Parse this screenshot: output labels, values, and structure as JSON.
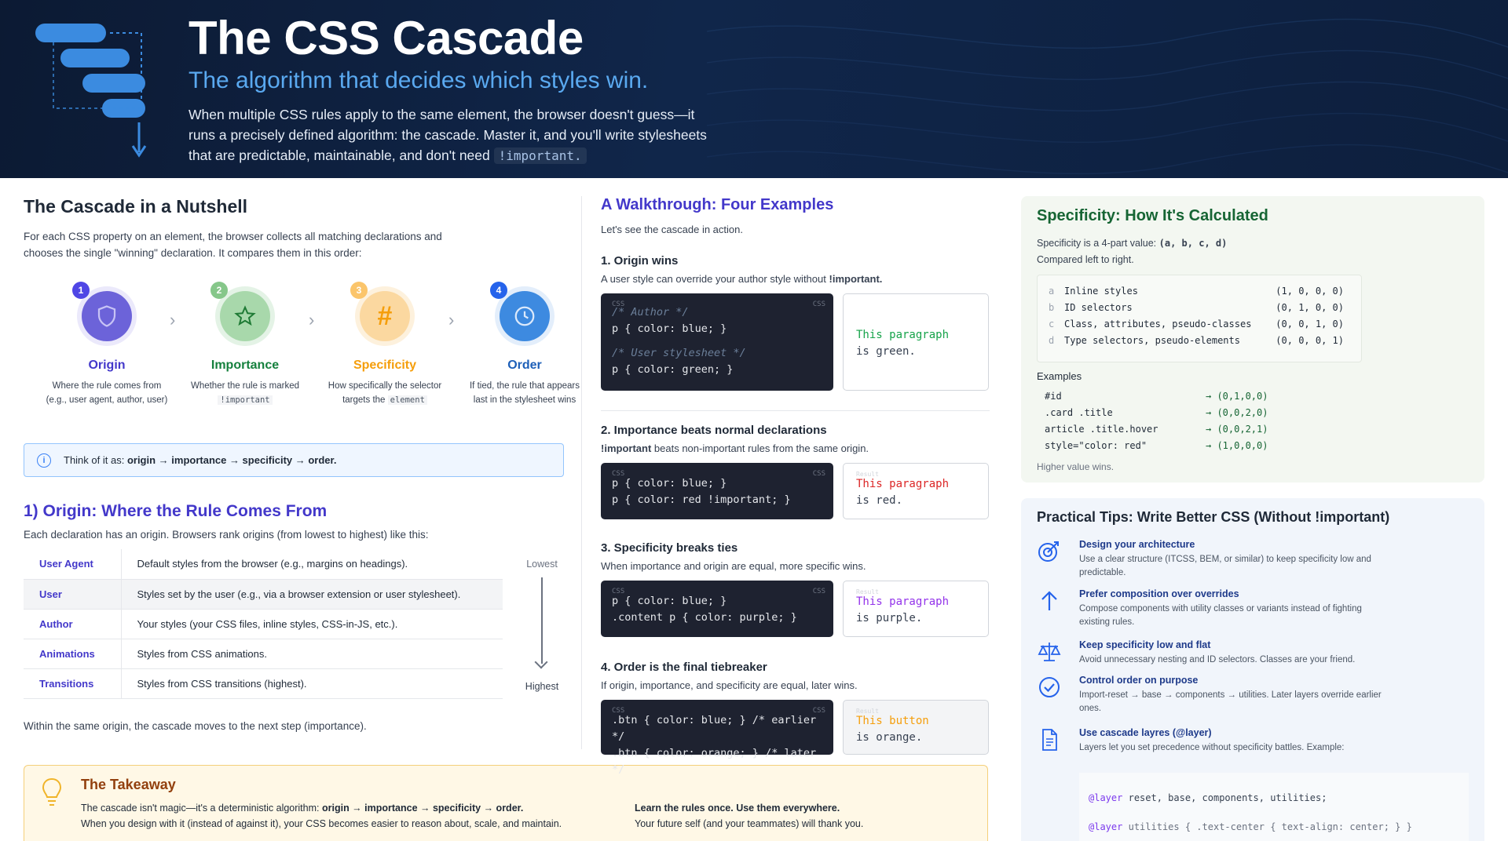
{
  "header": {
    "title": "The CSS Cascade",
    "subtitle": "The algorithm that decides which styles win.",
    "description": "When multiple CSS rules apply to the same element, the browser doesn't guess—it runs a precisely defined algorithm: the cascade. Master it, and you'll write stylesheets that are predictable, maintainable, and don't need",
    "description_code": "!important."
  },
  "nutshell": {
    "title": "The Cascade in a Nutshell",
    "intro": "For each CSS property on an element, the browser collects all matching declarations and chooses the single \"winning\" declaration. It compares them in this order:",
    "steps": [
      {
        "num": "1",
        "name": "Origin",
        "desc": "Where the rule comes from (e.g., user agent, author, user)",
        "icon": "shield-icon",
        "color": "#5b5bd6"
      },
      {
        "num": "2",
        "name": "Importance",
        "desc": "Whether the rule is marked",
        "code": "!important",
        "icon": "star-icon",
        "color": "#22a34a"
      },
      {
        "num": "3",
        "name": "Specificity",
        "desc": "How specifically the selector targets the",
        "code": "element",
        "icon": "hash-icon",
        "color": "#f59e0b"
      },
      {
        "num": "4",
        "name": "Order",
        "desc": "If tied, the rule that appears last in the stylesheet wins",
        "icon": "clock-icon",
        "color": "#2f7fd8"
      }
    ],
    "tip_prefix": "Think of it as:",
    "tip_bold": "origin → importance → specificity → order."
  },
  "origin": {
    "title": "1) Origin: Where the Rule Comes From",
    "intro": "Each declaration has an origin. Browsers rank origins (from lowest to highest) like this:",
    "rows": [
      {
        "name": "User Agent",
        "desc": "Default styles from the browser (e.g., margins on headings)."
      },
      {
        "name": "User",
        "desc": "Styles set by the user (e.g., via a browser extension or user stylesheet)."
      },
      {
        "name": "Author",
        "desc": "Your styles (your CSS files, inline styles, CSS-in-JS, etc.)."
      },
      {
        "name": "Animations",
        "desc": "Styles from CSS animations."
      },
      {
        "name": "Transitions",
        "desc": "Styles from CSS transitions (highest)."
      }
    ],
    "lowest": "Lowest",
    "highest": "Highest",
    "footer": "Within the same origin, the cascade moves to the next step (importance)."
  },
  "takeaway": {
    "title": "The Takeaway",
    "line1_prefix": "The cascade isn't magic—it's a deterministic algorithm:",
    "line1_bold": "origin → importance → specificity → order.",
    "line2": "When you design with it (instead of against it), your CSS becomes easier to reason about, scale, and maintain.",
    "right_bold": "Learn the rules once. Use them everywhere.",
    "right_line": "Your future self (and your teammates) will thank you."
  },
  "walkthrough": {
    "title": "A Walkthrough: Four Examples",
    "intro": "Let's see the cascade in action.",
    "examples": [
      {
        "heading": "1. Origin wins",
        "sub": "A user style can override your author style without",
        "sub_bold": "!important.",
        "code_label": "CSS",
        "code_label_right": "CSS",
        "lines": [
          "/* Author */",
          "p { color: blue; }",
          "/* User stylesheet */",
          "p { color: green; }"
        ],
        "out1": "This paragraph",
        "out2": "is green."
      },
      {
        "heading": "2. Importance beats normal declarations",
        "sub_bold": "!important",
        "sub": "beats non-important rules from the same origin.",
        "code_label": "CSS",
        "code_label_right": "CSS",
        "lines": [
          "p { color: blue; }",
          "p { color: red !important; }"
        ],
        "out_label": "Result",
        "out1": "This paragraph",
        "out2": "is red."
      },
      {
        "heading": "3. Specificity breaks ties",
        "sub": "When importance and origin are equal, more specific wins.",
        "code_label": "CSS",
        "code_label_right": "CSS",
        "lines": [
          "p { color: blue; }",
          ".content p { color: purple; }"
        ],
        "out_label": "Result",
        "out1": "This paragraph",
        "out2": "is purple."
      },
      {
        "heading": "4. Order is the final tiebreaker",
        "sub": "If origin, importance, and specificity are equal, later wins.",
        "code_label": "CSS",
        "code_label_right": "CSS",
        "lines": [
          ".btn { color: blue; }  /* earlier */",
          ".btn { color: orange; } /* later */"
        ],
        "out_label": "Result",
        "out1": "This button",
        "out2": "is orange."
      }
    ]
  },
  "specificity": {
    "title": "Specificity: How It's Calculated",
    "desc_prefix": "Specificity is a 4-part value:",
    "desc_bold": "(a, b, c, d)",
    "desc2": "Compared left to right.",
    "rows": [
      {
        "letter": "a",
        "label": "Inline styles",
        "value": "(1, 0, 0, 0)"
      },
      {
        "letter": "b",
        "label": "ID selectors",
        "value": "(0, 1, 0, 0)"
      },
      {
        "letter": "c",
        "label": "Class, attributes, pseudo-classes",
        "value": "(0, 0, 1, 0)"
      },
      {
        "letter": "d",
        "label": "Type selectors, pseudo-elements",
        "value": "(0, 0, 0, 1)"
      }
    ],
    "examples_title": "Examples",
    "examples": [
      {
        "sel": "#id",
        "value": "→ (0,1,0,0)"
      },
      {
        "sel": ".card .title",
        "value": "→ (0,0,2,0)"
      },
      {
        "sel": "article .title.hover",
        "value": "→ (0,0,2,1)"
      },
      {
        "sel": "style=\"color: red\"",
        "value": "→ (1,0,0,0)"
      }
    ],
    "footer": "Higher value wins."
  },
  "tips": {
    "title": "Practical Tips: Write Better CSS (Without !important)",
    "items": [
      {
        "icon": "target-icon",
        "title": "Design your architecture",
        "desc": "Use a clear structure (ITCSS, BEM, or similar) to keep specificity low and predictable."
      },
      {
        "icon": "arrow-up-icon",
        "title": "Prefer composition over overrides",
        "desc": "Compose components with utility classes or variants instead of fighting existing rules."
      },
      {
        "icon": "scale-icon",
        "title": "Keep specificity low and flat",
        "desc": "Avoid unnecessary nesting and ID selectors. Classes are your friend."
      },
      {
        "icon": "check-circle-icon",
        "title": "Control order on purpose",
        "desc": "Import-reset → base → components → utilities. Later layers override earlier ones."
      },
      {
        "icon": "document-icon",
        "title": "Use cascade layres (@layer)",
        "desc": "Layers let you set precedence without specificity battles. Example:"
      }
    ],
    "layer_line1_kw": "@layer",
    "layer_line1": "reset, base, components, utilities;",
    "layer_line2_kw": "@layer",
    "layer_line2": "utilities { .text-center { text-align: center; } }"
  },
  "colors": {
    "header_bg": "#0c1a33",
    "accent_blue": "#5aa9f0",
    "indigo": "#4338ca",
    "green": "#166534",
    "code_bg": "#1e2230"
  }
}
